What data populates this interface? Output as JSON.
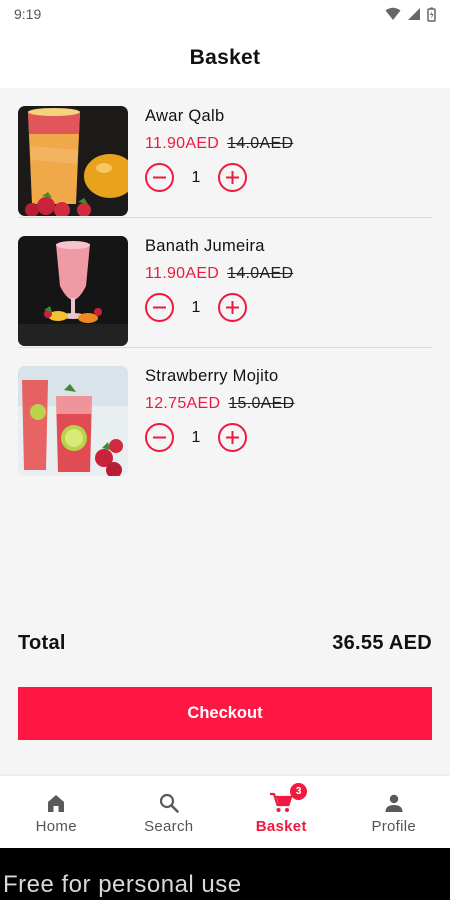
{
  "status_bar": {
    "time": "9:19"
  },
  "header": {
    "title": "Basket"
  },
  "items": [
    {
      "name": "Awar Qalb",
      "price": "11.90AED",
      "old_price": "14.0AED",
      "quantity": "1"
    },
    {
      "name": "Banath Jumeira",
      "price": "11.90AED",
      "old_price": "14.0AED",
      "quantity": "1"
    },
    {
      "name": "Strawberry Mojito",
      "price": "12.75AED",
      "old_price": "15.0AED",
      "quantity": "1"
    }
  ],
  "summary": {
    "total_label": "Total",
    "total_value": "36.55 AED"
  },
  "checkout_label": "Checkout",
  "bottom_nav": [
    {
      "label": "Home",
      "icon": "home-icon"
    },
    {
      "label": "Search",
      "icon": "search-icon"
    },
    {
      "label": "Basket",
      "icon": "cart-icon",
      "badge": "3",
      "active": true
    },
    {
      "label": "Profile",
      "icon": "person-icon"
    }
  ],
  "footer_text": "Free for personal use",
  "colors": {
    "accent": "#f0193f",
    "checkout_button": "#ff1744",
    "background": "#f5f5f5"
  }
}
